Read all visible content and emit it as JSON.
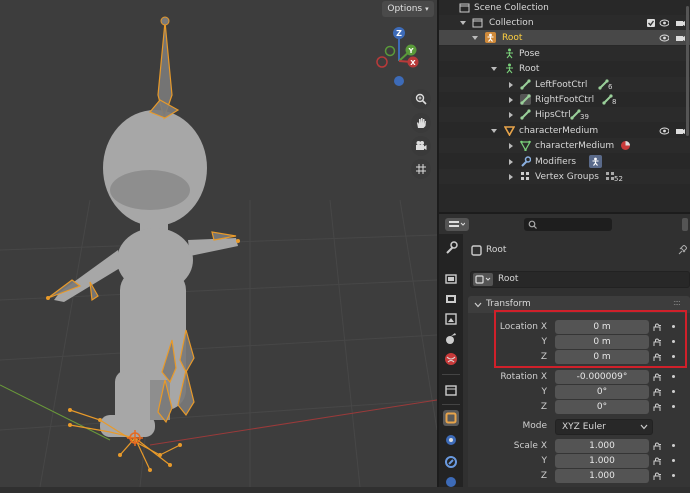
{
  "viewport": {
    "options_label": "Options",
    "gizmo": {
      "z": "Z",
      "y": "Y",
      "x": "X"
    },
    "nav_icons": [
      "zoom-icon",
      "hand-icon",
      "camera-icon",
      "grid-icon"
    ]
  },
  "outliner": {
    "scene_collection": "Scene Collection",
    "rows": [
      {
        "label": "Collection"
      },
      {
        "label": "Root"
      },
      {
        "label": "Pose"
      },
      {
        "label": "Root"
      },
      {
        "label": "LeftFootCtrl",
        "badge": "6"
      },
      {
        "label": "RightFootCtrl",
        "badge": "8"
      },
      {
        "label": "HipsCtrl",
        "badge": "39"
      },
      {
        "label": "characterMedium"
      },
      {
        "label": "characterMedium"
      },
      {
        "label": "Modifiers"
      },
      {
        "label": "Vertex Groups",
        "badge": "52"
      }
    ]
  },
  "properties": {
    "object_name": "Root",
    "datablock_name": "Root",
    "panel_title": "Transform",
    "location": {
      "label_x": "Location X",
      "label_y": "Y",
      "label_z": "Z",
      "x": "0 m",
      "y": "0 m",
      "z": "0 m"
    },
    "rotation": {
      "label_x": "Rotation X",
      "label_y": "Y",
      "label_z": "Z",
      "x": "-0.000009°",
      "y": "0°",
      "z": "0°"
    },
    "mode": {
      "label": "Mode",
      "value": "XYZ Euler"
    },
    "scale": {
      "label_x": "Scale X",
      "label_y": "Y",
      "label_z": "Z",
      "x": "1.000",
      "y": "1.000",
      "z": "1.000"
    },
    "colors": {
      "highlight": "#d0202a",
      "accent": "#e8a44a",
      "armature": "#e89a2a"
    }
  }
}
